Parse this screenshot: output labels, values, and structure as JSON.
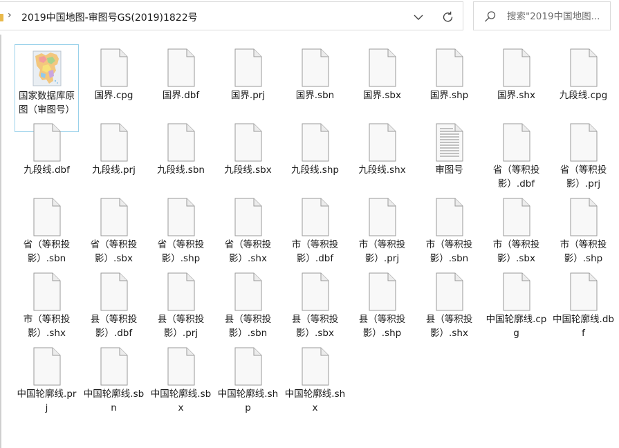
{
  "address_bar": {
    "path": "2019中国地图-审图号GS(2019)1822号"
  },
  "search": {
    "placeholder": "搜索\"2019中国地图..."
  },
  "files": [
    {
      "name": "国家数据库原图（审图号）",
      "icon": "image-thumbnail-icon",
      "selected": true
    },
    {
      "name": "国界.cpg",
      "icon": "file-icon"
    },
    {
      "name": "国界.dbf",
      "icon": "file-icon"
    },
    {
      "name": "国界.prj",
      "icon": "file-icon"
    },
    {
      "name": "国界.sbn",
      "icon": "file-icon"
    },
    {
      "name": "国界.sbx",
      "icon": "file-icon"
    },
    {
      "name": "国界.shp",
      "icon": "file-icon"
    },
    {
      "name": "国界.shx",
      "icon": "file-icon"
    },
    {
      "name": "九段线.cpg",
      "icon": "file-icon"
    },
    {
      "name": "九段线.dbf",
      "icon": "file-icon"
    },
    {
      "name": "九段线.prj",
      "icon": "file-icon"
    },
    {
      "name": "九段线.sbn",
      "icon": "file-icon"
    },
    {
      "name": "九段线.sbx",
      "icon": "file-icon"
    },
    {
      "name": "九段线.shp",
      "icon": "file-icon"
    },
    {
      "name": "九段线.shx",
      "icon": "file-icon"
    },
    {
      "name": "审图号",
      "icon": "text-file-icon"
    },
    {
      "name": "省（等积投影）.dbf",
      "icon": "file-icon"
    },
    {
      "name": "省（等积投影）.prj",
      "icon": "file-icon"
    },
    {
      "name": "省（等积投影）.sbn",
      "icon": "file-icon"
    },
    {
      "name": "省（等积投影）.sbx",
      "icon": "file-icon"
    },
    {
      "name": "省（等积投影）.shp",
      "icon": "file-icon"
    },
    {
      "name": "省（等积投影）.shx",
      "icon": "file-icon"
    },
    {
      "name": "市（等积投影）.dbf",
      "icon": "file-icon"
    },
    {
      "name": "市（等积投影）.prj",
      "icon": "file-icon"
    },
    {
      "name": "市（等积投影）.sbn",
      "icon": "file-icon"
    },
    {
      "name": "市（等积投影）.sbx",
      "icon": "file-icon"
    },
    {
      "name": "市（等积投影）.shp",
      "icon": "file-icon"
    },
    {
      "name": "市（等积投影）.shx",
      "icon": "file-icon"
    },
    {
      "name": "县（等积投影）.dbf",
      "icon": "file-icon"
    },
    {
      "name": "县（等积投影）.prj",
      "icon": "file-icon"
    },
    {
      "name": "县（等积投影）.sbn",
      "icon": "file-icon"
    },
    {
      "name": "县（等积投影）.sbx",
      "icon": "file-icon"
    },
    {
      "name": "县（等积投影）.shp",
      "icon": "file-icon"
    },
    {
      "name": "县（等积投影）.shx",
      "icon": "file-icon"
    },
    {
      "name": "中国轮廓线.cpg",
      "icon": "file-icon"
    },
    {
      "name": "中国轮廓线.dbf",
      "icon": "file-icon"
    },
    {
      "name": "中国轮廓线.prj",
      "icon": "file-icon"
    },
    {
      "name": "中国轮廓线.sbn",
      "icon": "file-icon"
    },
    {
      "name": "中国轮廓线.sbx",
      "icon": "file-icon"
    },
    {
      "name": "中国轮廓线.shp",
      "icon": "file-icon"
    },
    {
      "name": "中国轮廓线.shx",
      "icon": "file-icon"
    }
  ],
  "colors": {
    "selection_border": "#99d1ea",
    "folder": "#e9b94a",
    "bar_border": "#d9d9d9"
  }
}
